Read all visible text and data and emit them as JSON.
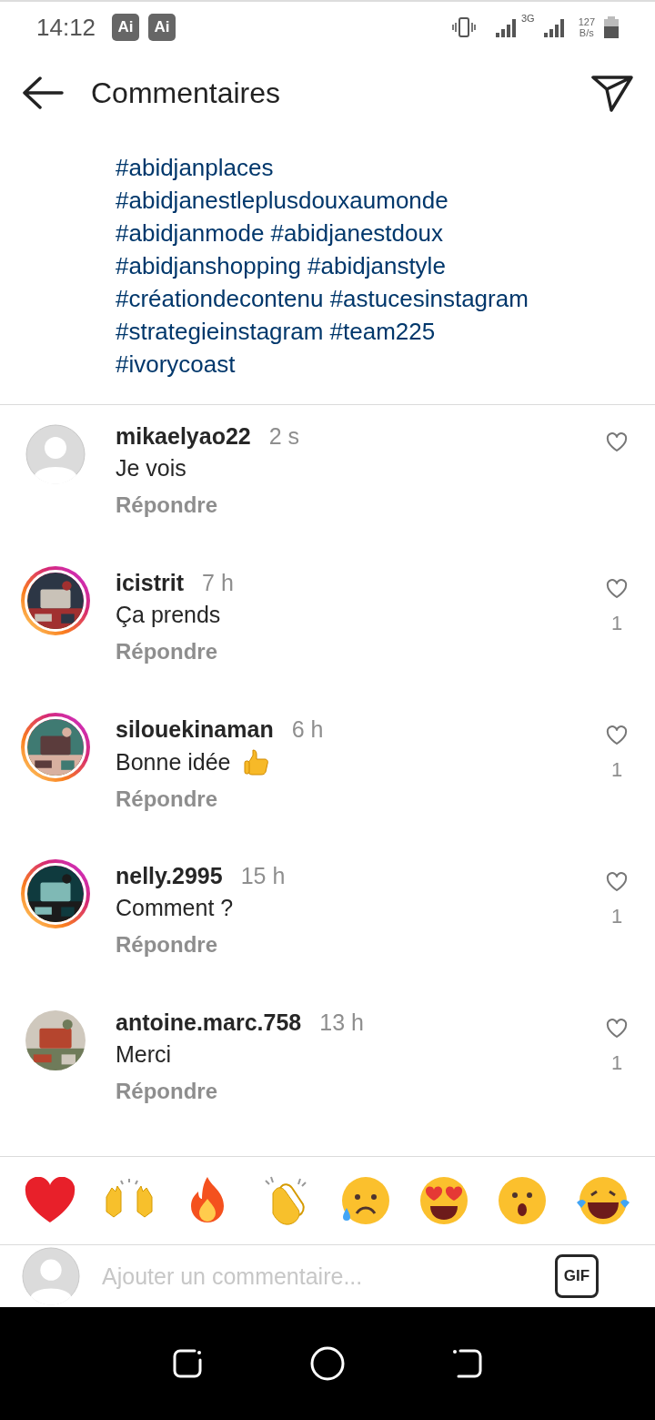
{
  "status_bar": {
    "time": "14:12",
    "badges": [
      "Ai",
      "Ai"
    ],
    "network": "3G",
    "speed_value": "127",
    "speed_unit": "B/s"
  },
  "header": {
    "title": "Commentaires"
  },
  "caption": {
    "lines": [
      "#abidjanplaces",
      "#abidjanestleplusdouxaumonde",
      "#abidjanmode #abidjanestdoux",
      "#abidjanshopping #abidjanstyle",
      "#créationdecontenu #astucesinstagram",
      "#strategieinstagram #team225",
      "#ivorycoast"
    ]
  },
  "comments": [
    {
      "username": "mikaelyao22",
      "time": "2 s",
      "text": "Je vois",
      "reply": "Répondre",
      "avatar": {
        "kind": "default"
      },
      "story_ring": false
    },
    {
      "username": "icistrit",
      "time": "7 h",
      "text": "Ça prends",
      "reply": "Répondre",
      "story_ring": true,
      "likes": "1"
    },
    {
      "username": "silouekinaman",
      "time": "6 h",
      "text": "Bonne idée",
      "emoji": {
        "kind": "thumbs_up"
      },
      "reply": "Répondre",
      "story_ring": true,
      "likes": "1"
    },
    {
      "username": "nelly.2995",
      "time": "15 h",
      "text": "Comment ?",
      "reply": "Répondre",
      "story_ring": true,
      "likes": "1"
    },
    {
      "username": "antoine.marc.758",
      "time": "13 h",
      "text": "Merci",
      "reply": "Répondre",
      "story_ring": false,
      "likes": "1"
    }
  ],
  "reactions": [
    {
      "kind": "heart"
    },
    {
      "kind": "raised_hands"
    },
    {
      "kind": "fire"
    },
    {
      "kind": "clap"
    },
    {
      "kind": "sad"
    },
    {
      "kind": "heart_eyes"
    },
    {
      "kind": "surprised"
    },
    {
      "kind": "laugh"
    }
  ],
  "composer": {
    "placeholder": "Ajouter un commentaire...",
    "gif": "GIF"
  }
}
